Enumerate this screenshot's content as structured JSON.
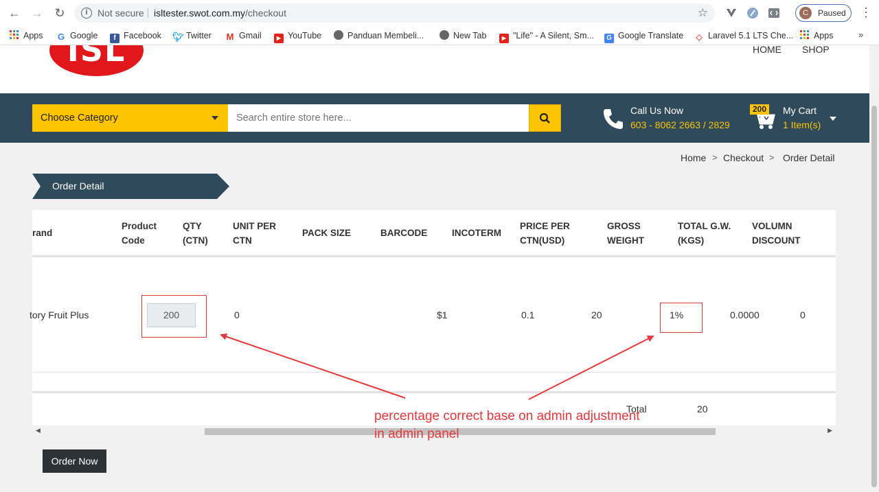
{
  "browser": {
    "security_label": "Not secure",
    "url_host": "isltester.swot.com.my",
    "url_path": "/checkout",
    "profile_initial": "C",
    "profile_status": "Paused",
    "bookmarks": [
      "Apps",
      "Google",
      "Facebook",
      "Twitter",
      "Gmail",
      "YouTube",
      "Panduan Membeli...",
      "New Tab",
      "\"Life\" - A Silent, Sm...",
      "Google Translate",
      "Laravel 5.1 LTS Che...",
      "Apps"
    ],
    "bookmarks_more": "»"
  },
  "site": {
    "logo_text": "ISL",
    "nav": [
      "HOME",
      "SHOP"
    ],
    "category_label": "Choose Category",
    "search_placeholder": "Search entire store here...",
    "call_label": "Call Us Now",
    "call_number": "603 - 8062 2663 / 2829",
    "cart_badge": "200",
    "cart_label": "My Cart",
    "cart_items": "1 Item(s)"
  },
  "breadcrumb": {
    "items": [
      "Home",
      "Checkout",
      "Order Detail"
    ],
    "separator": ">"
  },
  "order_tab": "Order Detail",
  "table": {
    "headers": [
      [
        "rand",
        ""
      ],
      [
        "Product",
        "Code"
      ],
      [
        "QTY",
        "(CTN)"
      ],
      [
        "UNIT PER",
        "CTN"
      ],
      [
        "PACK SIZE",
        ""
      ],
      [
        "BARCODE",
        ""
      ],
      [
        "INCOTERM",
        ""
      ],
      [
        "PRICE PER",
        "CTN(USD)"
      ],
      [
        "GROSS",
        "WEIGHT"
      ],
      [
        "TOTAL G.W.",
        "(KGS)"
      ],
      [
        "VOLUMN",
        "DISCOUNT"
      ]
    ],
    "row": {
      "brand": "tory Fruit Plus",
      "qty": "200",
      "unit_per_ctn": "0",
      "price": "$1",
      "gross_weight": "0.1",
      "total_gw": "20",
      "discount": "1%",
      "col_a": "0.0000",
      "col_b": "0"
    },
    "total_label": "Total",
    "total_value": "20"
  },
  "order_button": "Order Now",
  "annotation": {
    "line1": "percentage correct base on admin adjustment",
    "line2": "in admin panel",
    "color": "#e8383b"
  },
  "colors": {
    "header_bar": "#2f4a5a",
    "accent": "#fdc400",
    "logo_red": "#e2171c"
  }
}
